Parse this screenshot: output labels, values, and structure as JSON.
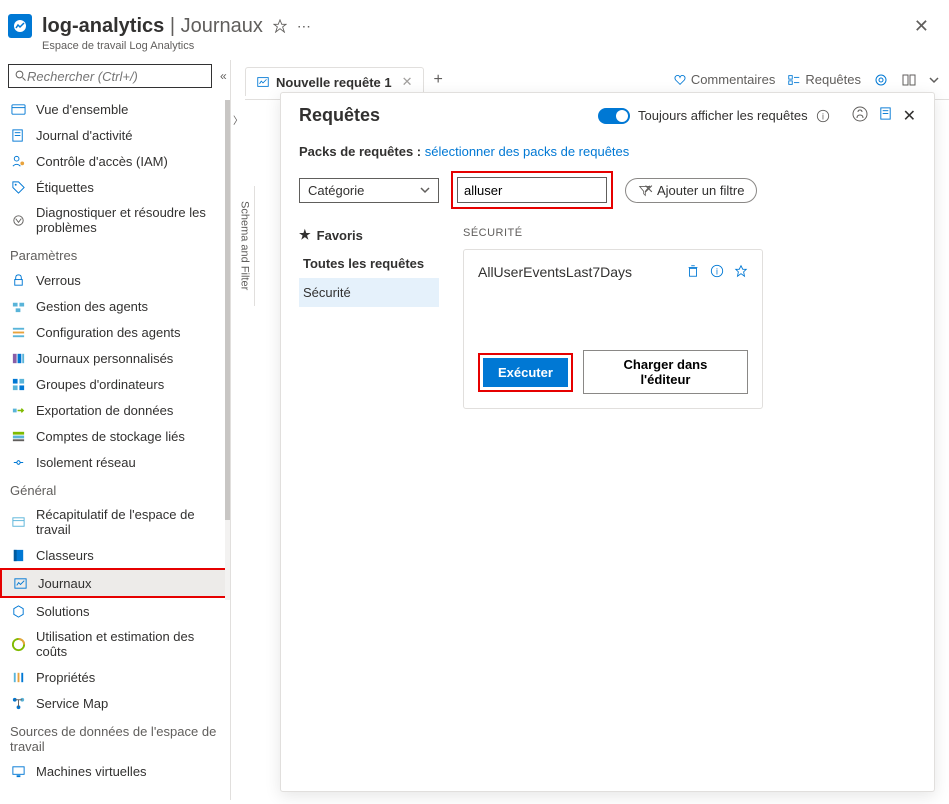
{
  "header": {
    "title": "log-analytics",
    "section": "Journaux",
    "caption": "Espace de travail Log Analytics"
  },
  "sidebar": {
    "search_placeholder": "Rechercher (Ctrl+/)",
    "items_top": [
      {
        "label": "Vue d'ensemble",
        "icon": "overview"
      },
      {
        "label": "Journal d'activité",
        "icon": "activity"
      },
      {
        "label": "Contrôle d'accès (IAM)",
        "icon": "iam"
      },
      {
        "label": "Étiquettes",
        "icon": "tags"
      },
      {
        "label": "Diagnostiquer et résoudre les problèmes",
        "icon": "diagnose"
      }
    ],
    "section_params": "Paramètres",
    "items_params": [
      {
        "label": "Verrous",
        "icon": "locks"
      },
      {
        "label": "Gestion des agents",
        "icon": "agents"
      },
      {
        "label": "Configuration des agents",
        "icon": "agentconf"
      },
      {
        "label": "Journaux personnalisés",
        "icon": "customlogs"
      },
      {
        "label": "Groupes d'ordinateurs",
        "icon": "groups"
      },
      {
        "label": "Exportation de données",
        "icon": "export"
      },
      {
        "label": "Comptes de stockage liés",
        "icon": "storage"
      },
      {
        "label": "Isolement réseau",
        "icon": "network"
      }
    ],
    "section_general": "Général",
    "items_general": [
      {
        "label": "Récapitulatif de l'espace de travail",
        "icon": "summary"
      },
      {
        "label": "Classeurs",
        "icon": "workbooks"
      },
      {
        "label": "Journaux",
        "icon": "logs",
        "selected": true,
        "highlighted": true
      },
      {
        "label": "Solutions",
        "icon": "solutions"
      },
      {
        "label": "Utilisation et estimation des coûts",
        "icon": "usage"
      },
      {
        "label": "Propriétés",
        "icon": "properties"
      },
      {
        "label": "Service Map",
        "icon": "servicemap"
      }
    ],
    "section_sources": "Sources de données de l'espace de travail",
    "items_sources": [
      {
        "label": "Machines virtuelles",
        "icon": "vms"
      }
    ]
  },
  "tabbar": {
    "tab_label": "Nouvelle requête 1",
    "comments": "Commentaires",
    "queries": "Requêtes"
  },
  "schema_label": "Schema and Filter",
  "modal": {
    "title": "Requêtes",
    "always_show": "Toujours afficher les requêtes",
    "packs_label": "Packs de requêtes :",
    "packs_link": "sélectionner des packs de requêtes",
    "category_label": "Catégorie",
    "search_value": "alluser",
    "add_filter": "Ajouter un filtre",
    "favorites": "Favoris",
    "all_queries": "Toutes les requêtes",
    "category_security": "Sécurité",
    "section_security": "SÉCURITÉ",
    "query_name": "AllUserEventsLast7Days",
    "btn_execute": "Exécuter",
    "btn_load": "Charger dans l'éditeur"
  }
}
